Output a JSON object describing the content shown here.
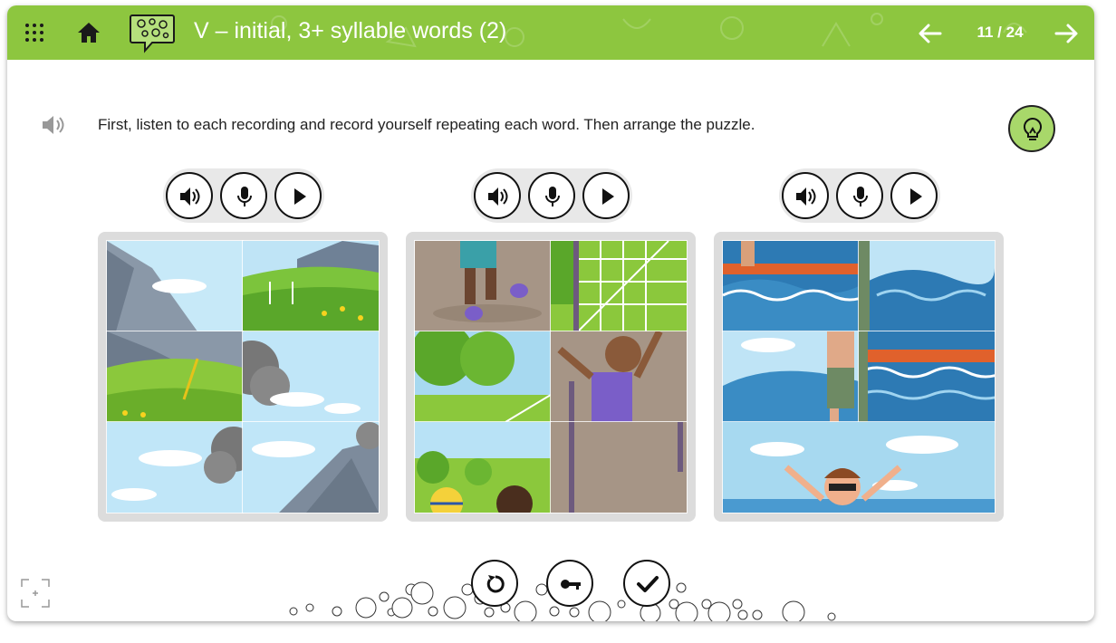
{
  "header": {
    "title": "V – initial, 3+ syllable words (2)",
    "page_indicator": "11 / 24",
    "accent_color": "#8dc63f",
    "icons": [
      "grid-menu-icon",
      "home-icon",
      "speech-bubble-logo-icon",
      "arrow-left-icon",
      "arrow-right-icon"
    ]
  },
  "instruction": {
    "text": "First, listen to each recording and record yourself repeating each word. Then arrange the puzzle.",
    "icons": [
      "speaker-icon",
      "lightbulb-icon"
    ]
  },
  "word_groups": [
    {
      "controls": [
        "speaker-icon",
        "microphone-icon",
        "play-icon"
      ],
      "puzzle": "volcano"
    },
    {
      "controls": [
        "speaker-icon",
        "microphone-icon",
        "play-icon"
      ],
      "puzzle": "volleyball"
    },
    {
      "controls": [
        "speaker-icon",
        "microphone-icon",
        "play-icon"
      ],
      "puzzle": "surfing"
    }
  ],
  "actions": {
    "icons": [
      "reset-icon",
      "key-icon",
      "check-icon"
    ]
  }
}
